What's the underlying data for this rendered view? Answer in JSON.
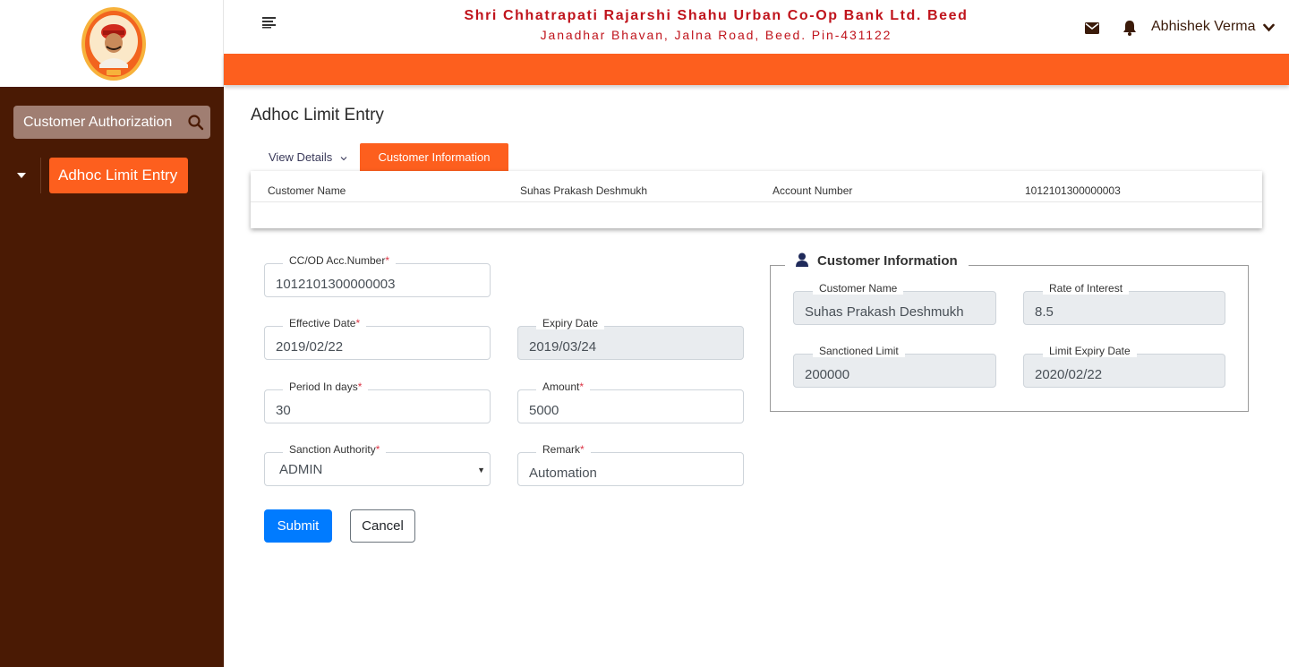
{
  "header": {
    "bank_name": "Shri Chhatrapati Rajarshi Shahu Urban Co-Op Bank Ltd. Beed",
    "bank_address": "Janadhar Bhavan, Jalna Road, Beed. Pin-431122",
    "user_name": "Abhishek Verma"
  },
  "sidebar": {
    "search_value": "Customer Authorization",
    "menu_item": "Adhoc Limit Entry"
  },
  "page": {
    "title": "Adhoc Limit Entry",
    "tab_view_details": "View Details",
    "tab_customer_info": "Customer Information"
  },
  "info_card": {
    "customer_name_label": "Customer Name",
    "customer_name_value": "Suhas Prakash Deshmukh",
    "account_number_label": "Account Number",
    "account_number_value": "1012101300000003"
  },
  "form": {
    "acc_number": {
      "label": "CC/OD Acc.Number",
      "value": "1012101300000003",
      "required": "*"
    },
    "effective_date": {
      "label": "Effective Date",
      "value": "2019/02/22",
      "required": "*"
    },
    "expiry_date": {
      "label": "Expiry Date",
      "value": "2019/03/24"
    },
    "period_days": {
      "label": "Period In days",
      "value": "30",
      "required": "*"
    },
    "amount": {
      "label": "Amount",
      "value": "5000",
      "required": "*"
    },
    "sanction_authority": {
      "label": "Sanction Authority",
      "value": "ADMIN",
      "required": "*"
    },
    "remark": {
      "label": "Remark",
      "value": "Automation",
      "required": "*"
    },
    "submit_label": "Submit",
    "cancel_label": "Cancel"
  },
  "customer_info": {
    "legend": "Customer Information",
    "customer_name": {
      "label": "Customer Name",
      "value": "Suhas Prakash Deshmukh"
    },
    "rate_of_interest": {
      "label": "Rate of Interest",
      "value": "8.5"
    },
    "sanctioned_limit": {
      "label": "Sanctioned Limit",
      "value": "200000"
    },
    "limit_expiry_date": {
      "label": "Limit Expiry Date",
      "value": "2020/02/22"
    }
  },
  "icons": {
    "hamburger": "menu-icon",
    "mail": "envelope-icon",
    "bell": "bell-icon",
    "user_chevron": "chevron-down-icon",
    "search": "search-icon",
    "legend_icon": "user-icon"
  },
  "colors": {
    "sidebar_bg": "#4a1a04",
    "accent_orange": "#fd5f1e",
    "bank_red": "#c0141c",
    "primary_blue": "#007bff"
  }
}
